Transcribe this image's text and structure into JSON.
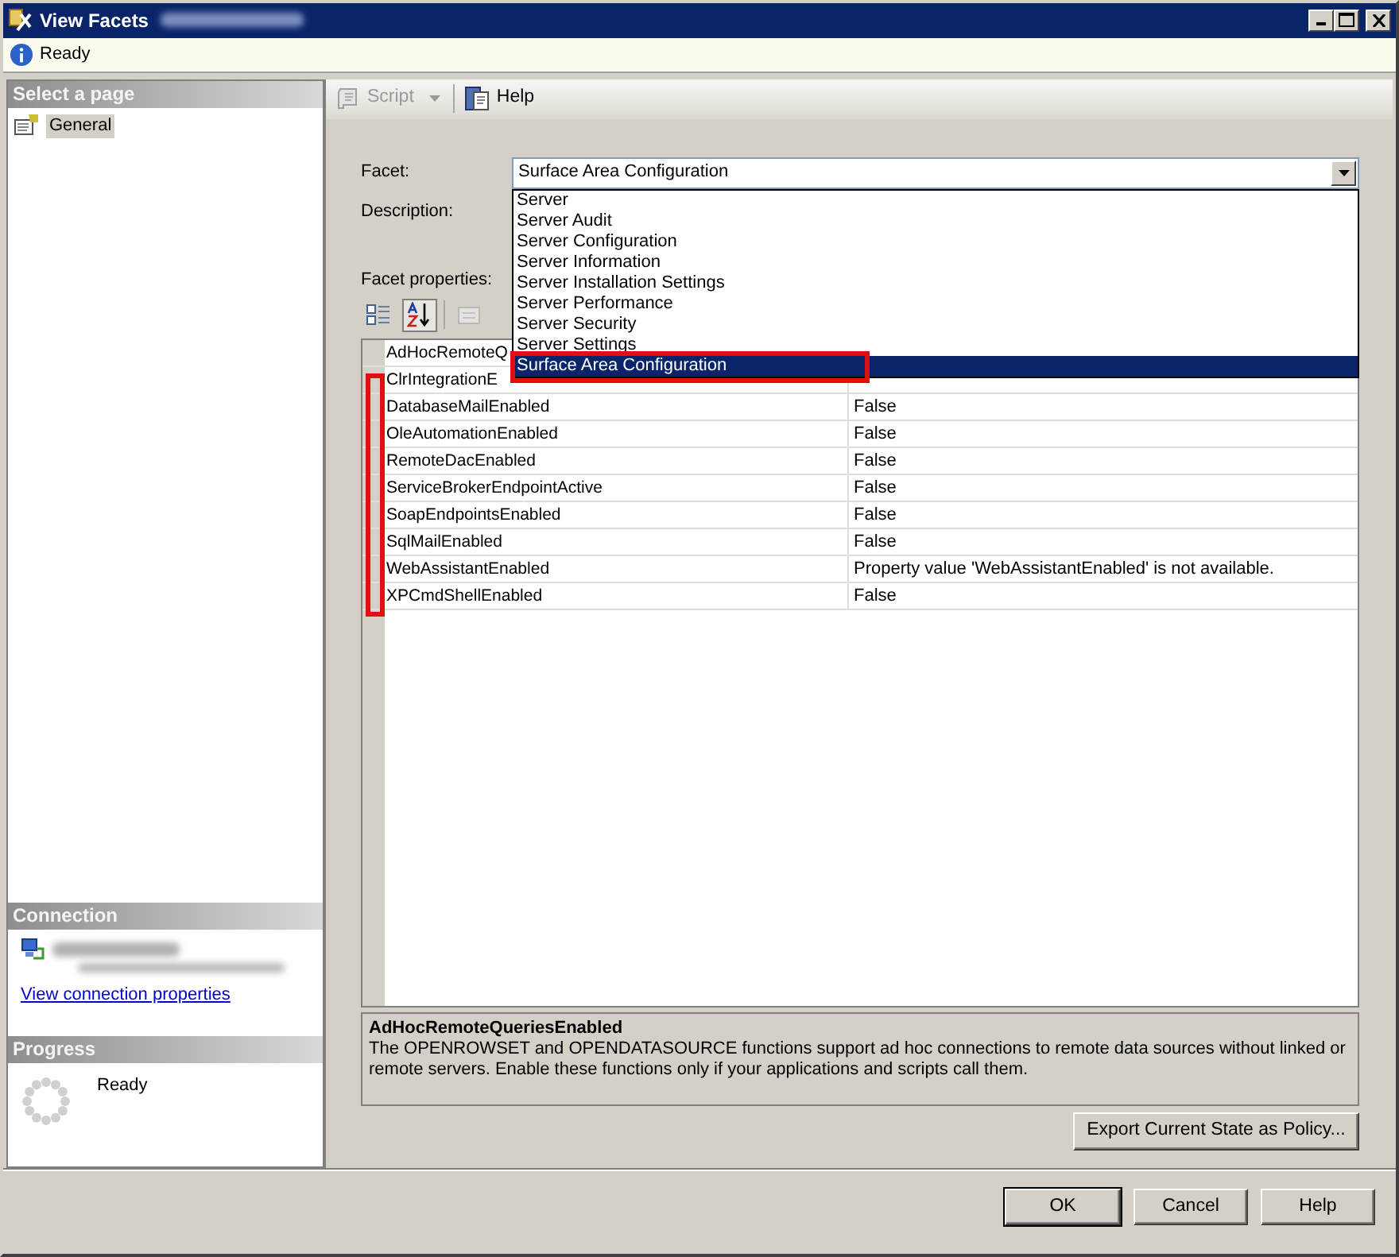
{
  "window": {
    "title": "View Facets"
  },
  "info_bar": {
    "text": "Ready"
  },
  "sidebar": {
    "pages_header": "Select a page",
    "pages": [
      {
        "label": "General",
        "selected": true
      }
    ],
    "connection_header": "Connection",
    "connection_link": "View connection properties",
    "progress_header": "Progress",
    "progress_status": "Ready"
  },
  "toolbar": [
    {
      "label": "Script",
      "kind": "script",
      "disabled": true
    },
    {
      "label": "Help",
      "kind": "help",
      "disabled": false
    }
  ],
  "facet": {
    "label": "Facet:",
    "value": "Surface Area Configuration",
    "options": [
      {
        "label": "Server",
        "selected": false
      },
      {
        "label": "Server Audit",
        "selected": false
      },
      {
        "label": "Server Configuration",
        "selected": false
      },
      {
        "label": "Server Information",
        "selected": false
      },
      {
        "label": "Server Installation Settings",
        "selected": false
      },
      {
        "label": "Server Performance",
        "selected": false
      },
      {
        "label": "Server Security",
        "selected": false
      },
      {
        "label": "Server Settings",
        "selected": false,
        "framed": false
      },
      {
        "label": "Surface Area Configuration",
        "selected": true,
        "framed": true
      }
    ]
  },
  "description_label": "Description:",
  "properties_label": "Facet properties:",
  "grid_tools": [
    {
      "kind": "categorized",
      "selected": false,
      "disabled": false
    },
    {
      "kind": "alphabetical",
      "selected": true,
      "disabled": false
    },
    {
      "kind": "property-pages",
      "selected": false,
      "disabled": true
    }
  ],
  "rows": [
    {
      "name": "AdHocRemoteQ"
    },
    {
      "name": "ClrIntegrationE"
    },
    {
      "name": "DatabaseMailEnabled",
      "value": "False"
    },
    {
      "name": "OleAutomationEnabled",
      "value": "False"
    },
    {
      "name": "RemoteDacEnabled",
      "value": "False"
    },
    {
      "name": "ServiceBrokerEndpointActive",
      "value": "False"
    },
    {
      "name": "SoapEndpointsEnabled",
      "value": "False"
    },
    {
      "name": "SqlMailEnabled",
      "value": "False"
    },
    {
      "name": "WebAssistantEnabled",
      "value": "Property value 'WebAssistantEnabled' is not available."
    },
    {
      "name": "XPCmdShellEnabled",
      "value": "False"
    }
  ],
  "rows_bracket": true,
  "help_pane": {
    "title": "AdHocRemoteQueriesEnabled",
    "text": "The OPENROWSET and OPENDATASOURCE functions support ad hoc connections to remote data sources without linked or remote servers. Enable these functions only if your applications and scripts call them."
  },
  "export_button": "Export Current State as Policy...",
  "buttons": [
    {
      "label": "OK",
      "default": true
    },
    {
      "label": "Cancel",
      "default": false
    },
    {
      "label": "Help",
      "default": false
    }
  ]
}
